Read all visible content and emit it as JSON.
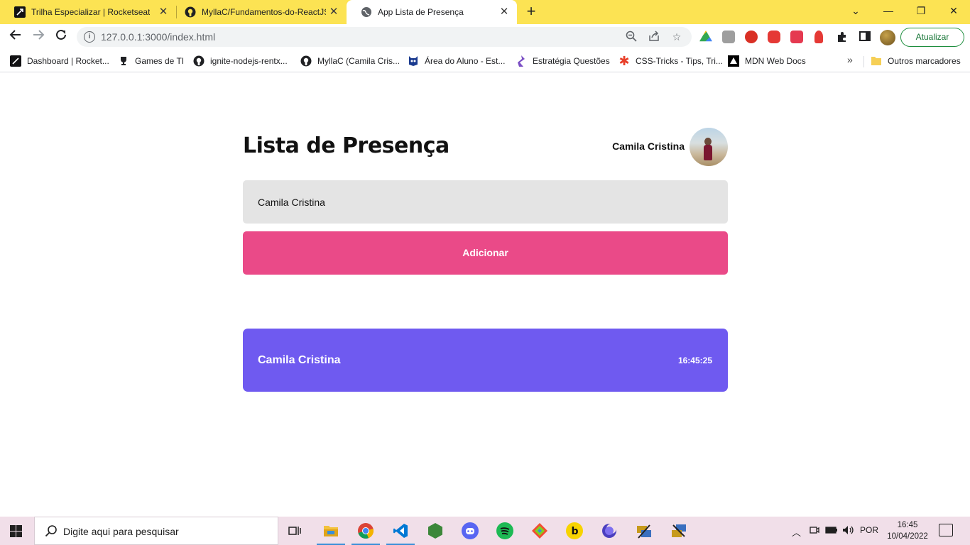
{
  "browser": {
    "tabs": [
      {
        "label": "Trilha Especializar | Rocketseat"
      },
      {
        "label": "MyllaC/Fundamentos-do-ReactJS"
      },
      {
        "label": "App Lista de Presença"
      }
    ],
    "address": "127.0.0.1:3000/index.html",
    "update_label": "Atualizar",
    "bookmarks": [
      {
        "label": "Dashboard | Rocket..."
      },
      {
        "label": "Games de TI"
      },
      {
        "label": "ignite-nodejs-rentx..."
      },
      {
        "label": "MyllaC (Camila Cris..."
      },
      {
        "label": "Área do Aluno - Est..."
      },
      {
        "label": "Estratégia Questões"
      },
      {
        "label": "CSS-Tricks - Tips, Tri..."
      },
      {
        "label": "MDN Web Docs"
      }
    ],
    "other_bookmarks": "Outros marcadores",
    "more_bookmarks": "»"
  },
  "app": {
    "title": "Lista de Presença",
    "user_name": "Camila Cristina",
    "input_value": "Camila Cristina",
    "add_button": "Adicionar",
    "attendees": [
      {
        "name": "Camila Cristina",
        "time": "16:45:25"
      }
    ]
  },
  "taskbar": {
    "search_placeholder": "Digite aqui para pesquisar",
    "language": "POR",
    "time": "16:45",
    "date": "10/04/2022"
  },
  "colors": {
    "tab_strip": "#fce353",
    "accent_button": "#ea4a88",
    "card": "#6f5af0"
  }
}
